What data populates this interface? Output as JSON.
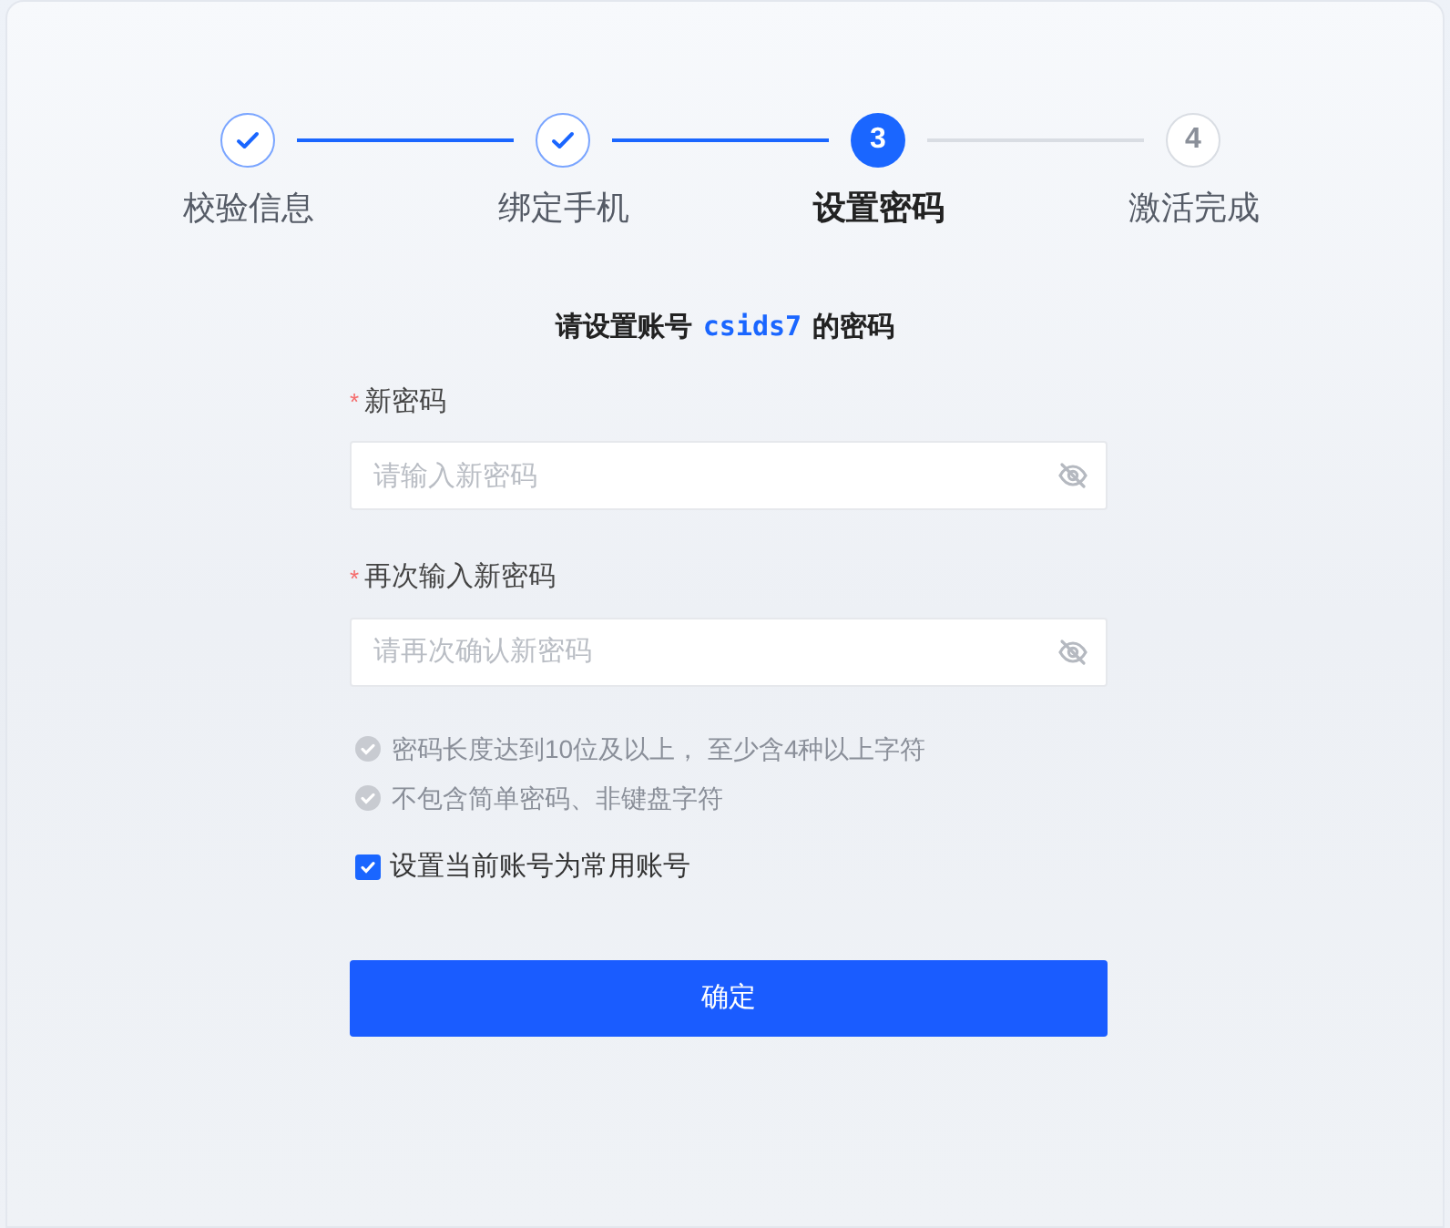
{
  "steps": [
    {
      "label": "校验信息",
      "done": true,
      "selected": false
    },
    {
      "label": "绑定手机",
      "done": true,
      "selected": false
    },
    {
      "number": "3",
      "label": "设置密码",
      "done": false,
      "selected": true
    },
    {
      "number": "4",
      "label": "激活完成",
      "done": false,
      "selected": false
    }
  ],
  "heading": {
    "before": "请设置账号",
    "account": "csids7",
    "after": "的密码"
  },
  "fields": [
    {
      "required_mark": "*",
      "label": "新密码",
      "placeholder": "请输入新密码"
    },
    {
      "required_mark": "*",
      "label": "再次输入新密码",
      "placeholder": "请再次确认新密码"
    }
  ],
  "rules": [
    {
      "text": "密码长度达到10位及以上， 至少含4种以上字符",
      "met": false
    },
    {
      "text": "不包含简单密码、非键盘字符",
      "met": false
    }
  ],
  "remember": {
    "label": "设置当前账号为常用账号",
    "checked": true
  },
  "submit": "确定"
}
